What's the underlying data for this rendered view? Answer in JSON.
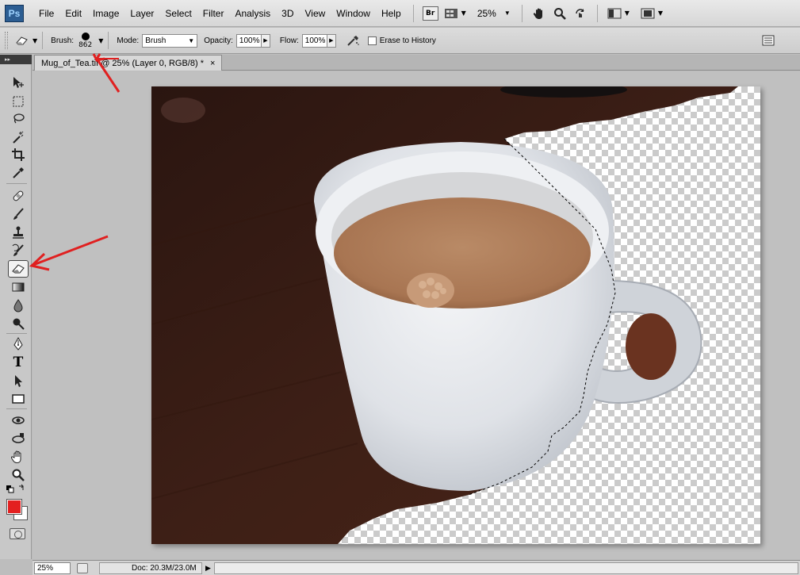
{
  "app": {
    "logo_text": "Ps",
    "menu": [
      "File",
      "Edit",
      "Image",
      "Layer",
      "Select",
      "Filter",
      "Analysis",
      "3D",
      "View",
      "Window",
      "Help"
    ],
    "bridge_label": "Br",
    "zoom": "25%"
  },
  "options": {
    "brush_label": "Brush:",
    "brush_size": "862",
    "mode_label": "Mode:",
    "mode_value": "Brush",
    "opacity_label": "Opacity:",
    "opacity_value": "100%",
    "flow_label": "Flow:",
    "flow_value": "100%",
    "erase_history_label": "Erase to History"
  },
  "document": {
    "tab_title": "Mug_of_Tea.tif @ 25% (Layer 0, RGB/8) *",
    "close": "×"
  },
  "tools": {
    "active": "eraser-tool",
    "foreground_color": "#e32020",
    "background_color": "#ffffff",
    "type_tool_glyph": "T"
  },
  "status": {
    "zoom": "25%",
    "doc_info": "Doc: 20.3M/23.0M"
  },
  "annotations": {
    "color": "#e02020"
  }
}
